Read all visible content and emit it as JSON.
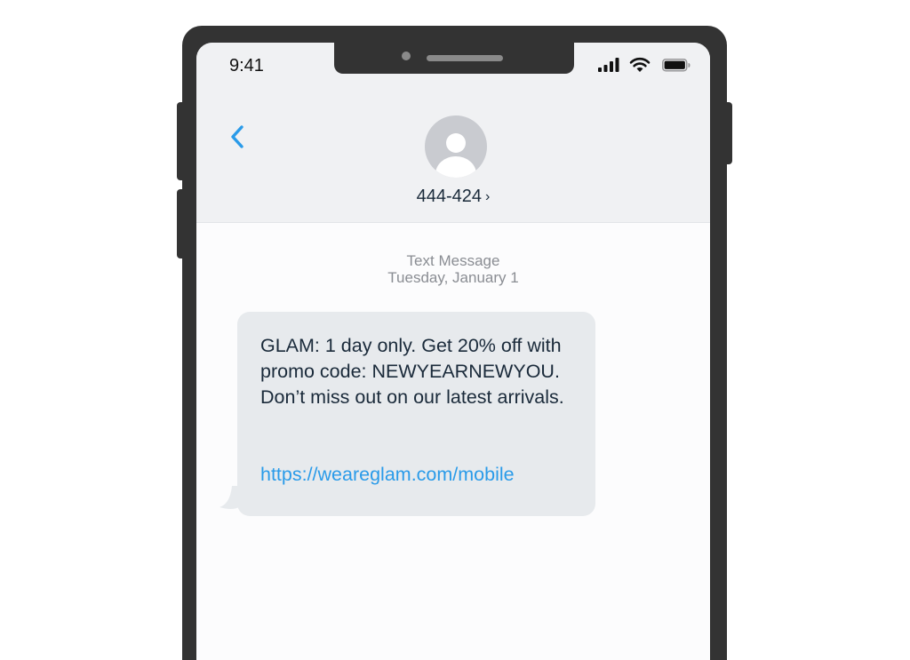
{
  "status_bar": {
    "time": "9:41",
    "icons": [
      "cellular-signal-icon",
      "wifi-icon",
      "battery-icon"
    ]
  },
  "header": {
    "back_icon": "chevron-left-icon",
    "avatar_icon": "person-silhouette-icon",
    "contact_name": "444-424",
    "contact_chevron": "›"
  },
  "conversation": {
    "meta_type": "Text Message",
    "meta_date": "Tuesday, January 1",
    "messages": [
      {
        "direction": "incoming",
        "text": "GLAM: 1 day only. Get 20% off with promo code: NEWYEARNEWYOU. Don’t miss out on our latest arrivals.",
        "link": "https://weareglam.com/mobile"
      }
    ]
  },
  "colors": {
    "phone_frame": "#333333",
    "header_bg": "#f0f1f3",
    "bubble_bg": "#e7eaed",
    "link": "#2a9be9",
    "back_icon": "#2a9be9",
    "text": "#1a2a3a",
    "meta_text": "#8a8d93"
  }
}
